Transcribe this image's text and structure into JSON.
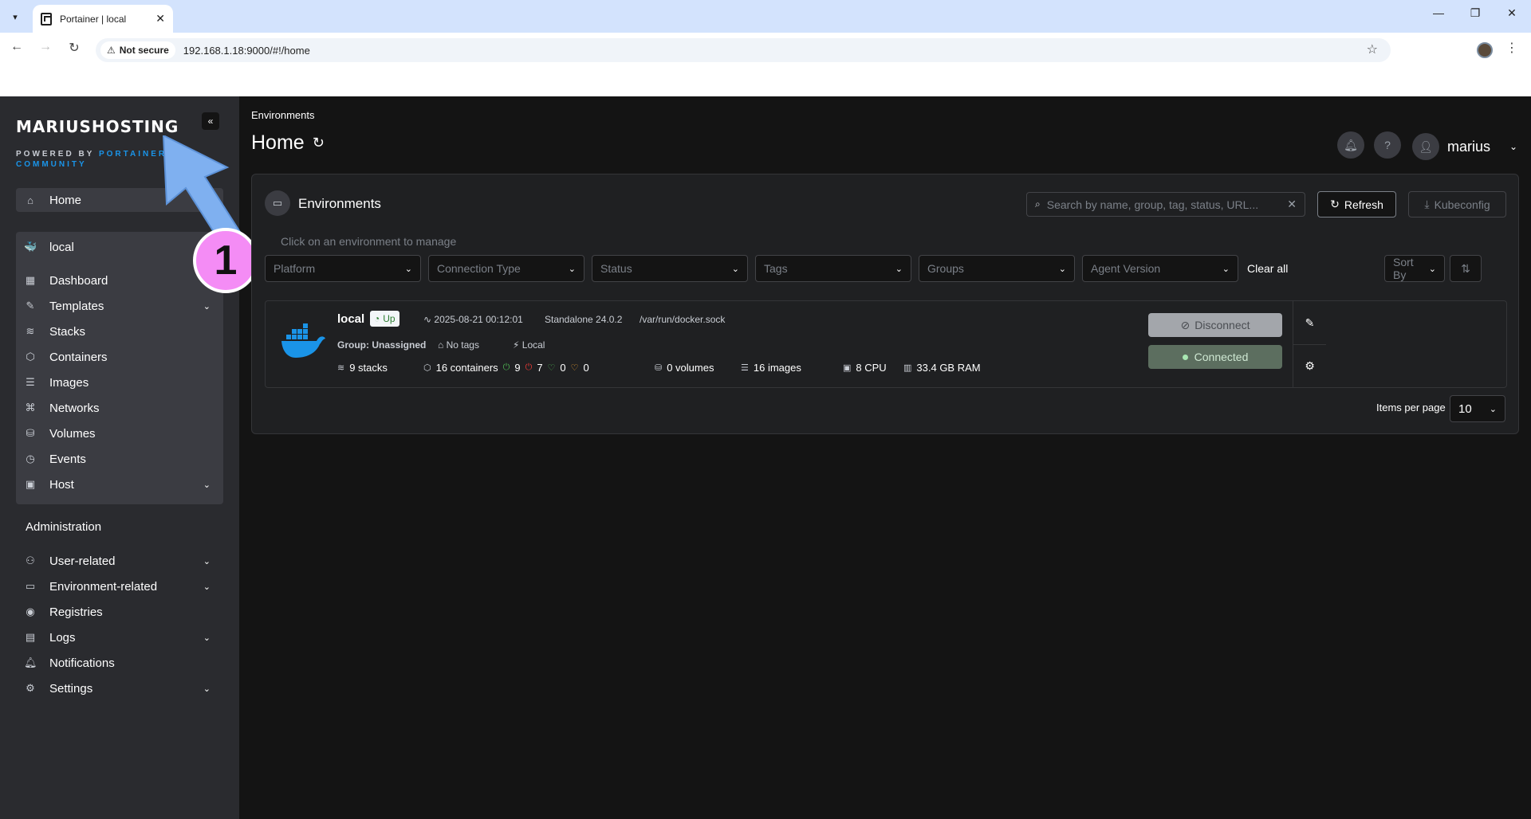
{
  "browser": {
    "tab_title": "Portainer | local",
    "not_secure": "Not secure",
    "url": "192.168.1.18:9000/#!/home"
  },
  "sidebar": {
    "brand": "MARIUSHOSTING",
    "powered_by": "POWERED BY",
    "portainer": "PORTAINER",
    "community": "COMMUNITY",
    "home": "Home",
    "environment": "local",
    "env_items": [
      {
        "label": "Dashboard",
        "icon": "dashboard-icon"
      },
      {
        "label": "Templates",
        "icon": "edit-icon"
      },
      {
        "label": "Stacks",
        "icon": "layers-icon"
      },
      {
        "label": "Containers",
        "icon": "box-icon"
      },
      {
        "label": "Images",
        "icon": "list-icon"
      },
      {
        "label": "Networks",
        "icon": "network-icon"
      },
      {
        "label": "Volumes",
        "icon": "database-icon"
      },
      {
        "label": "Events",
        "icon": "clock-icon"
      },
      {
        "label": "Host",
        "icon": "host-icon"
      }
    ],
    "administration": "Administration",
    "admin_items": [
      {
        "label": "User-related",
        "icon": "users-icon"
      },
      {
        "label": "Environment-related",
        "icon": "drive-icon"
      },
      {
        "label": "Registries",
        "icon": "radio-icon"
      },
      {
        "label": "Logs",
        "icon": "file-icon"
      },
      {
        "label": "Notifications",
        "icon": "bell-icon"
      },
      {
        "label": "Settings",
        "icon": "gear-icon"
      }
    ]
  },
  "annotation": {
    "number": "1",
    "color": "#f48cf5",
    "arrow_color": "#7fb0f0"
  },
  "header": {
    "breadcrumb": "Environments",
    "title": "Home",
    "username": "marius"
  },
  "environments": {
    "title": "Environments",
    "search_placeholder": "Search by name, group, tag, status, URL...",
    "refresh": "Refresh",
    "kubeconfig": "Kubeconfig",
    "hint": "Click on an environment to manage",
    "filters": [
      "Platform",
      "Connection Type",
      "Status",
      "Tags",
      "Groups",
      "Agent Version"
    ],
    "clear_all": "Clear all",
    "sort_by": "Sort By",
    "items": [
      {
        "name": "local",
        "status": "Up",
        "timestamp": "2025-08-21 00:12:01",
        "type": "Standalone 24.0.2",
        "socket": "/var/run/docker.sock",
        "group": "Group: Unassigned",
        "tags": "No tags",
        "location": "Local",
        "stacks": "9 stacks",
        "containers": "16 containers",
        "running": "9",
        "stopped": "7",
        "healthy": "0",
        "unhealthy": "0",
        "volumes": "0 volumes",
        "images": "16 images",
        "cpu": "8 CPU",
        "ram": "33.4 GB RAM",
        "disconnect": "Disconnect",
        "connected": "Connected"
      }
    ],
    "items_per_page_label": "Items per page",
    "items_per_page": "10"
  },
  "colors": {
    "accent": "#1a94e8",
    "connected": "#5c6e5f",
    "running": "#4caf50",
    "stopped": "#e53935",
    "healthy": "#4caf50",
    "unhealthy": "#f0a030"
  }
}
